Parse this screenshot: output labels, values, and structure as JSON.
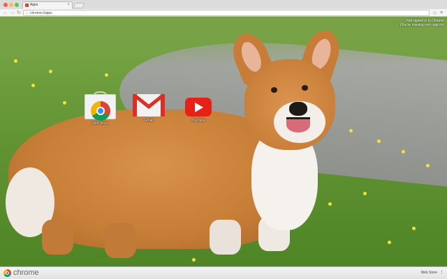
{
  "window": {
    "tab_title": "Apps",
    "url": "chrome://apps",
    "tab_close_glyph": "×",
    "nav": {
      "back": "←",
      "forward": "→",
      "reload": "↻"
    },
    "bookmark_glyph": "☆",
    "menu_glyph": "≡"
  },
  "page": {
    "signin_line1": "Not signed in to Chrome",
    "signin_line2": "(You're missing out—sign in)",
    "apps": [
      {
        "label": "Web Store",
        "icon": "webstore-icon"
      },
      {
        "label": "Gmail",
        "icon": "gmail-icon"
      },
      {
        "label": "YouTube",
        "icon": "youtube-icon"
      }
    ]
  },
  "bottom_bar": {
    "brand": "chrome",
    "link": "Web Store",
    "more_glyph": "⋮"
  },
  "colors": {
    "gmail_red": "#d93025",
    "youtube_red": "#e62117",
    "chrome_blue": "#4285f4"
  }
}
